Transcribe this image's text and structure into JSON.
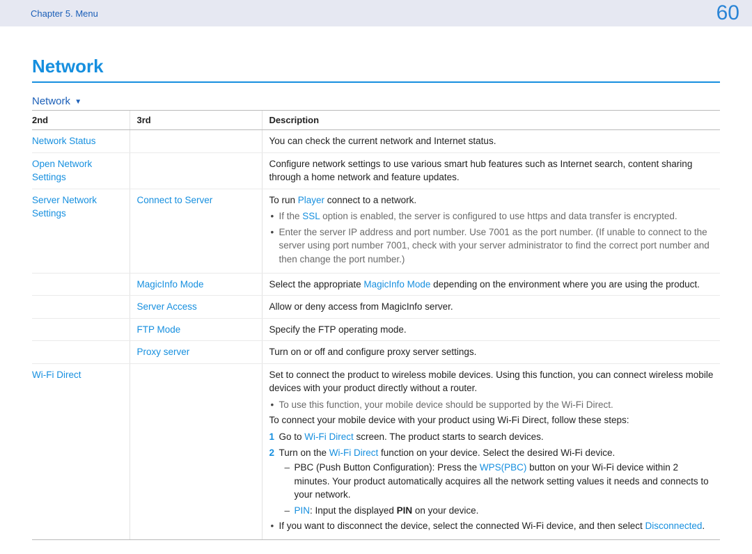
{
  "header": {
    "breadcrumb": "Chapter 5. Menu",
    "page_number": "60"
  },
  "title": "Network",
  "section_title": "Network",
  "columns": {
    "c2": "2nd",
    "c3": "3rd",
    "desc": "Description"
  },
  "rows": {
    "network_status": {
      "second": "Network Status",
      "desc": "You can check the current network and Internet status."
    },
    "open_network": {
      "second": "Open Network Settings",
      "desc": "Configure network settings to use various smart hub features such as Internet search, content sharing through a home network and feature updates."
    },
    "server_network": {
      "second": "Server Network Settings",
      "connect": {
        "third": "Connect to Server",
        "lead_pre": "To run ",
        "lead_link": "Player",
        "lead_post": " connect to a network.",
        "bul_ssl_pre": "If the ",
        "bul_ssl_word": "SSL",
        "bul_ssl_post": " option is enabled, the server is configured to use https and data transfer is encrypted.",
        "bul_port": "Enter the server IP address and port number. Use 7001 as the port number. (If unable to connect to the server using port number 7001, check with your server administrator to find the correct port number and then change the port number.)"
      },
      "magicinfo": {
        "third": "MagicInfo Mode",
        "pre": "Select the appropriate ",
        "link": "MagicInfo Mode",
        "post": " depending on the environment where you are using the product."
      },
      "server_access": {
        "third": "Server Access",
        "desc": "Allow or deny access from MagicInfo server."
      },
      "ftp": {
        "third": "FTP Mode",
        "desc": "Specify the FTP operating mode."
      },
      "proxy": {
        "third": "Proxy server",
        "desc": "Turn on or off and configure proxy server settings."
      }
    },
    "wifi": {
      "second": "Wi-Fi Direct",
      "p1": "Set to connect the product to wireless mobile devices. Using this function, you can connect wireless mobile devices with your product directly without a router.",
      "note": "To use this function, your mobile device should be supported by the Wi-Fi Direct.",
      "p2": "To connect your mobile device with your product using Wi-Fi Direct, follow these steps:",
      "step1_pre": "Go to ",
      "step1_link": "Wi-Fi Direct",
      "step1_post": " screen. The product starts to search devices.",
      "step2_pre": "Turn on the ",
      "step2_link": "Wi-Fi Direct",
      "step2_post": " function on your device. Select the desired Wi-Fi device.",
      "pbc_pre": "PBC (Push Button Configuration): Press the ",
      "pbc_link": "WPS(PBC)",
      "pbc_post": " button on your Wi-Fi device within 2 minutes. Your product automatically acquires all the network setting values it needs and connects to your network.",
      "pin_label": "PIN",
      "pin_mid": ": Input the displayed ",
      "pin_word": "PIN",
      "pin_post": " on your device.",
      "disc_pre": "If you want to disconnect the device, select the connected Wi-Fi device, and then select ",
      "disc_link": "Disconnected",
      "disc_post": "."
    }
  }
}
